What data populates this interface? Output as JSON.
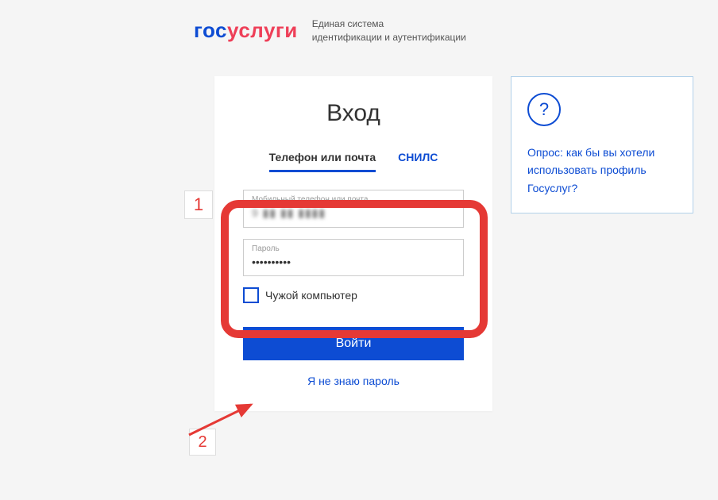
{
  "header": {
    "logo_part1": "гос",
    "logo_part2": "услуги",
    "subtitle_line1": "Единая система",
    "subtitle_line2": "идентификации и аутентификации"
  },
  "login": {
    "title": "Вход",
    "tab_phone": "Телефон или почта",
    "tab_snils": "СНИЛС",
    "phone_label": "Мобильный телефон или почта",
    "phone_value": "9 ▮▮ ▮▮ ▮▮▮▮",
    "password_label": "Пароль",
    "password_value": "••••••••••",
    "foreign_pc": "Чужой компьютер",
    "submit": "Войти",
    "forgot": "Я не знаю пароль"
  },
  "survey": {
    "icon": "?",
    "text": "Опрос: как бы вы хотели использовать профиль Госуслуг?"
  },
  "annotations": {
    "one": "1",
    "two": "2"
  }
}
